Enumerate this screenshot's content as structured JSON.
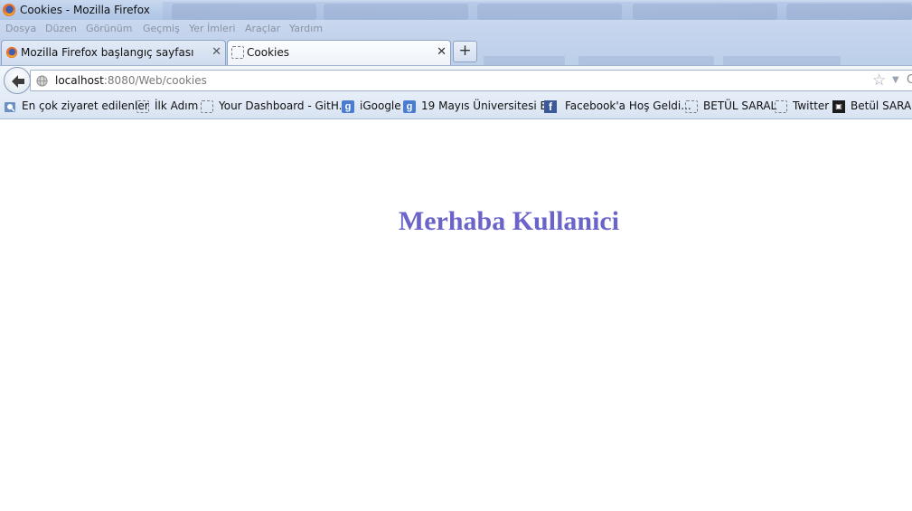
{
  "window": {
    "title": "Cookies - Mozilla Firefox"
  },
  "menu": [
    "Dosya",
    "Düzen",
    "Görünüm",
    "Geçmiş",
    "Yer İmleri",
    "Araçlar",
    "Yardım"
  ],
  "tabs": [
    {
      "label": "Mozilla Firefox başlangıç sayfası",
      "icon": "firefox-icon",
      "active": false
    },
    {
      "label": "Cookies",
      "icon": "blank-page-icon",
      "active": true
    }
  ],
  "nav": {
    "url_host": "localhost",
    "url_rest": ":8080/Web/cookies"
  },
  "bookmarks": [
    {
      "label": "En çok ziyaret edilenler",
      "icon": "smart-folder-icon"
    },
    {
      "label": "İlk Adım",
      "icon": "blank-page-icon"
    },
    {
      "label": "Your Dashboard - GitH...",
      "icon": "blank-page-icon"
    },
    {
      "label": "iGoogle",
      "icon": "google-icon"
    },
    {
      "label": "19 Mayıs Üniversitesi B...",
      "icon": "google-icon"
    },
    {
      "label": "Facebook'a Hoş Geldi...",
      "icon": "facebook-icon"
    },
    {
      "label": "BETÜL SARAL",
      "icon": "blank-page-icon"
    },
    {
      "label": "Twitter",
      "icon": "blank-page-icon"
    },
    {
      "label": "Betül SARAL",
      "icon": "github-icon"
    }
  ],
  "page": {
    "heading": "Merhaba Kullanici",
    "heading_color": "#6a63c9"
  }
}
